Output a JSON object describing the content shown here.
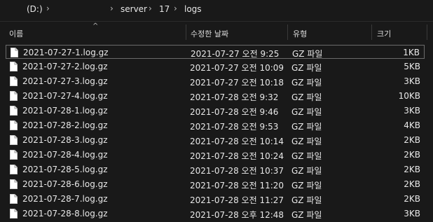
{
  "breadcrumb": {
    "drive": "(D:)",
    "path": [
      "server",
      "17",
      "logs"
    ]
  },
  "columns": {
    "name": "이름",
    "date": "수정한 날짜",
    "type": "유형",
    "size": "크기"
  },
  "files": [
    {
      "name": "2021-07-27-1.log.gz",
      "date": "2021-07-27 오전 9:25",
      "type": "GZ 파일",
      "size": "1KB",
      "selected": true
    },
    {
      "name": "2021-07-27-2.log.gz",
      "date": "2021-07-27 오전 10:09",
      "type": "GZ 파일",
      "size": "5KB"
    },
    {
      "name": "2021-07-27-3.log.gz",
      "date": "2021-07-27 오전 10:18",
      "type": "GZ 파일",
      "size": "3KB"
    },
    {
      "name": "2021-07-27-4.log.gz",
      "date": "2021-07-28 오전 9:32",
      "type": "GZ 파일",
      "size": "10KB"
    },
    {
      "name": "2021-07-28-1.log.gz",
      "date": "2021-07-28 오전 9:46",
      "type": "GZ 파일",
      "size": "3KB"
    },
    {
      "name": "2021-07-28-2.log.gz",
      "date": "2021-07-28 오전 9:53",
      "type": "GZ 파일",
      "size": "4KB"
    },
    {
      "name": "2021-07-28-3.log.gz",
      "date": "2021-07-28 오전 10:14",
      "type": "GZ 파일",
      "size": "2KB"
    },
    {
      "name": "2021-07-28-4.log.gz",
      "date": "2021-07-28 오전 10:24",
      "type": "GZ 파일",
      "size": "2KB"
    },
    {
      "name": "2021-07-28-5.log.gz",
      "date": "2021-07-28 오전 10:37",
      "type": "GZ 파일",
      "size": "2KB"
    },
    {
      "name": "2021-07-28-6.log.gz",
      "date": "2021-07-28 오전 11:20",
      "type": "GZ 파일",
      "size": "2KB"
    },
    {
      "name": "2021-07-28-7.log.gz",
      "date": "2021-07-28 오전 11:27",
      "type": "GZ 파일",
      "size": "2KB"
    },
    {
      "name": "2021-07-28-8.log.gz",
      "date": "2021-07-28 오후 12:48",
      "type": "GZ 파일",
      "size": "3KB"
    }
  ]
}
